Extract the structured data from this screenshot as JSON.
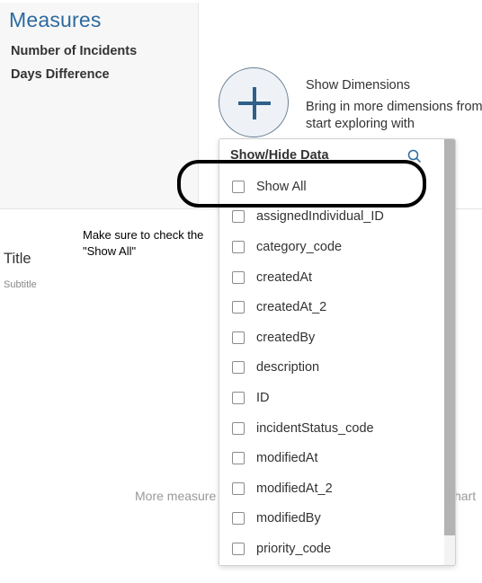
{
  "measures": {
    "title": "Measures",
    "items": [
      "Number of Incidents",
      "Days Difference"
    ]
  },
  "dimensions": {
    "show_title": "Show Dimensions",
    "show_desc": "Bring in more dimensions from start exploring with"
  },
  "annotation": {
    "note": "Make sure to check the \"Show All\""
  },
  "chart": {
    "title": "Title",
    "subtitle": "Subtitle",
    "hint_left": "More measure",
    "hint_right": "hart"
  },
  "dropdown": {
    "header": "Show/Hide Data",
    "items": [
      {
        "label": "Show All",
        "checked": false
      },
      {
        "label": "assignedIndividual_ID",
        "checked": false
      },
      {
        "label": "category_code",
        "checked": false
      },
      {
        "label": "createdAt",
        "checked": false
      },
      {
        "label": "createdAt_2",
        "checked": false
      },
      {
        "label": "createdBy",
        "checked": false
      },
      {
        "label": "description",
        "checked": false
      },
      {
        "label": "ID",
        "checked": false
      },
      {
        "label": "incidentStatus_code",
        "checked": false
      },
      {
        "label": "modifiedAt",
        "checked": false
      },
      {
        "label": "modifiedAt_2",
        "checked": false
      },
      {
        "label": "modifiedBy",
        "checked": false
      },
      {
        "label": "priority_code",
        "checked": false
      }
    ]
  },
  "icons": {
    "add": "plus-icon",
    "search": "search-icon",
    "checkbox": "checkbox-icon"
  },
  "colors": {
    "accent": "#2d6a9f",
    "annotation_outline": "#000000"
  }
}
